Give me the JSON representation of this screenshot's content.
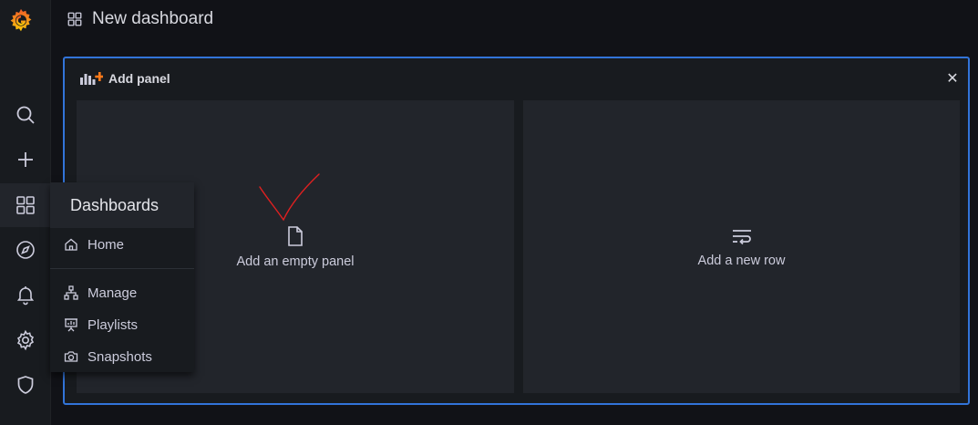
{
  "topbar": {
    "title": "New dashboard",
    "icon": "dashboard-grid-icon"
  },
  "sidebar": {
    "items": [
      {
        "name": "search",
        "icon": "search-icon"
      },
      {
        "name": "create",
        "icon": "plus-icon"
      },
      {
        "name": "dashboards",
        "icon": "grid-icon"
      },
      {
        "name": "explore",
        "icon": "compass-icon"
      },
      {
        "name": "alerting",
        "icon": "bell-icon"
      },
      {
        "name": "configuration",
        "icon": "gear-icon"
      },
      {
        "name": "server-admin",
        "icon": "shield-icon"
      }
    ]
  },
  "dashboards_menu": {
    "title": "Dashboards",
    "items": [
      {
        "label": "Home",
        "icon": "home-icon"
      },
      {
        "label": "Manage",
        "icon": "sitemap-icon"
      },
      {
        "label": "Playlists",
        "icon": "presentation-icon"
      },
      {
        "label": "Snapshots",
        "icon": "camera-icon"
      }
    ]
  },
  "add_panel": {
    "title": "Add panel",
    "options": [
      {
        "label": "Add an empty panel",
        "icon": "file-icon"
      },
      {
        "label": "Add a new row",
        "icon": "wrap-text-icon"
      }
    ]
  },
  "colors": {
    "accent": "#3274d9",
    "background": "#111217",
    "panel": "#181b1f",
    "card": "#22252b",
    "annotation": "#e02020"
  }
}
